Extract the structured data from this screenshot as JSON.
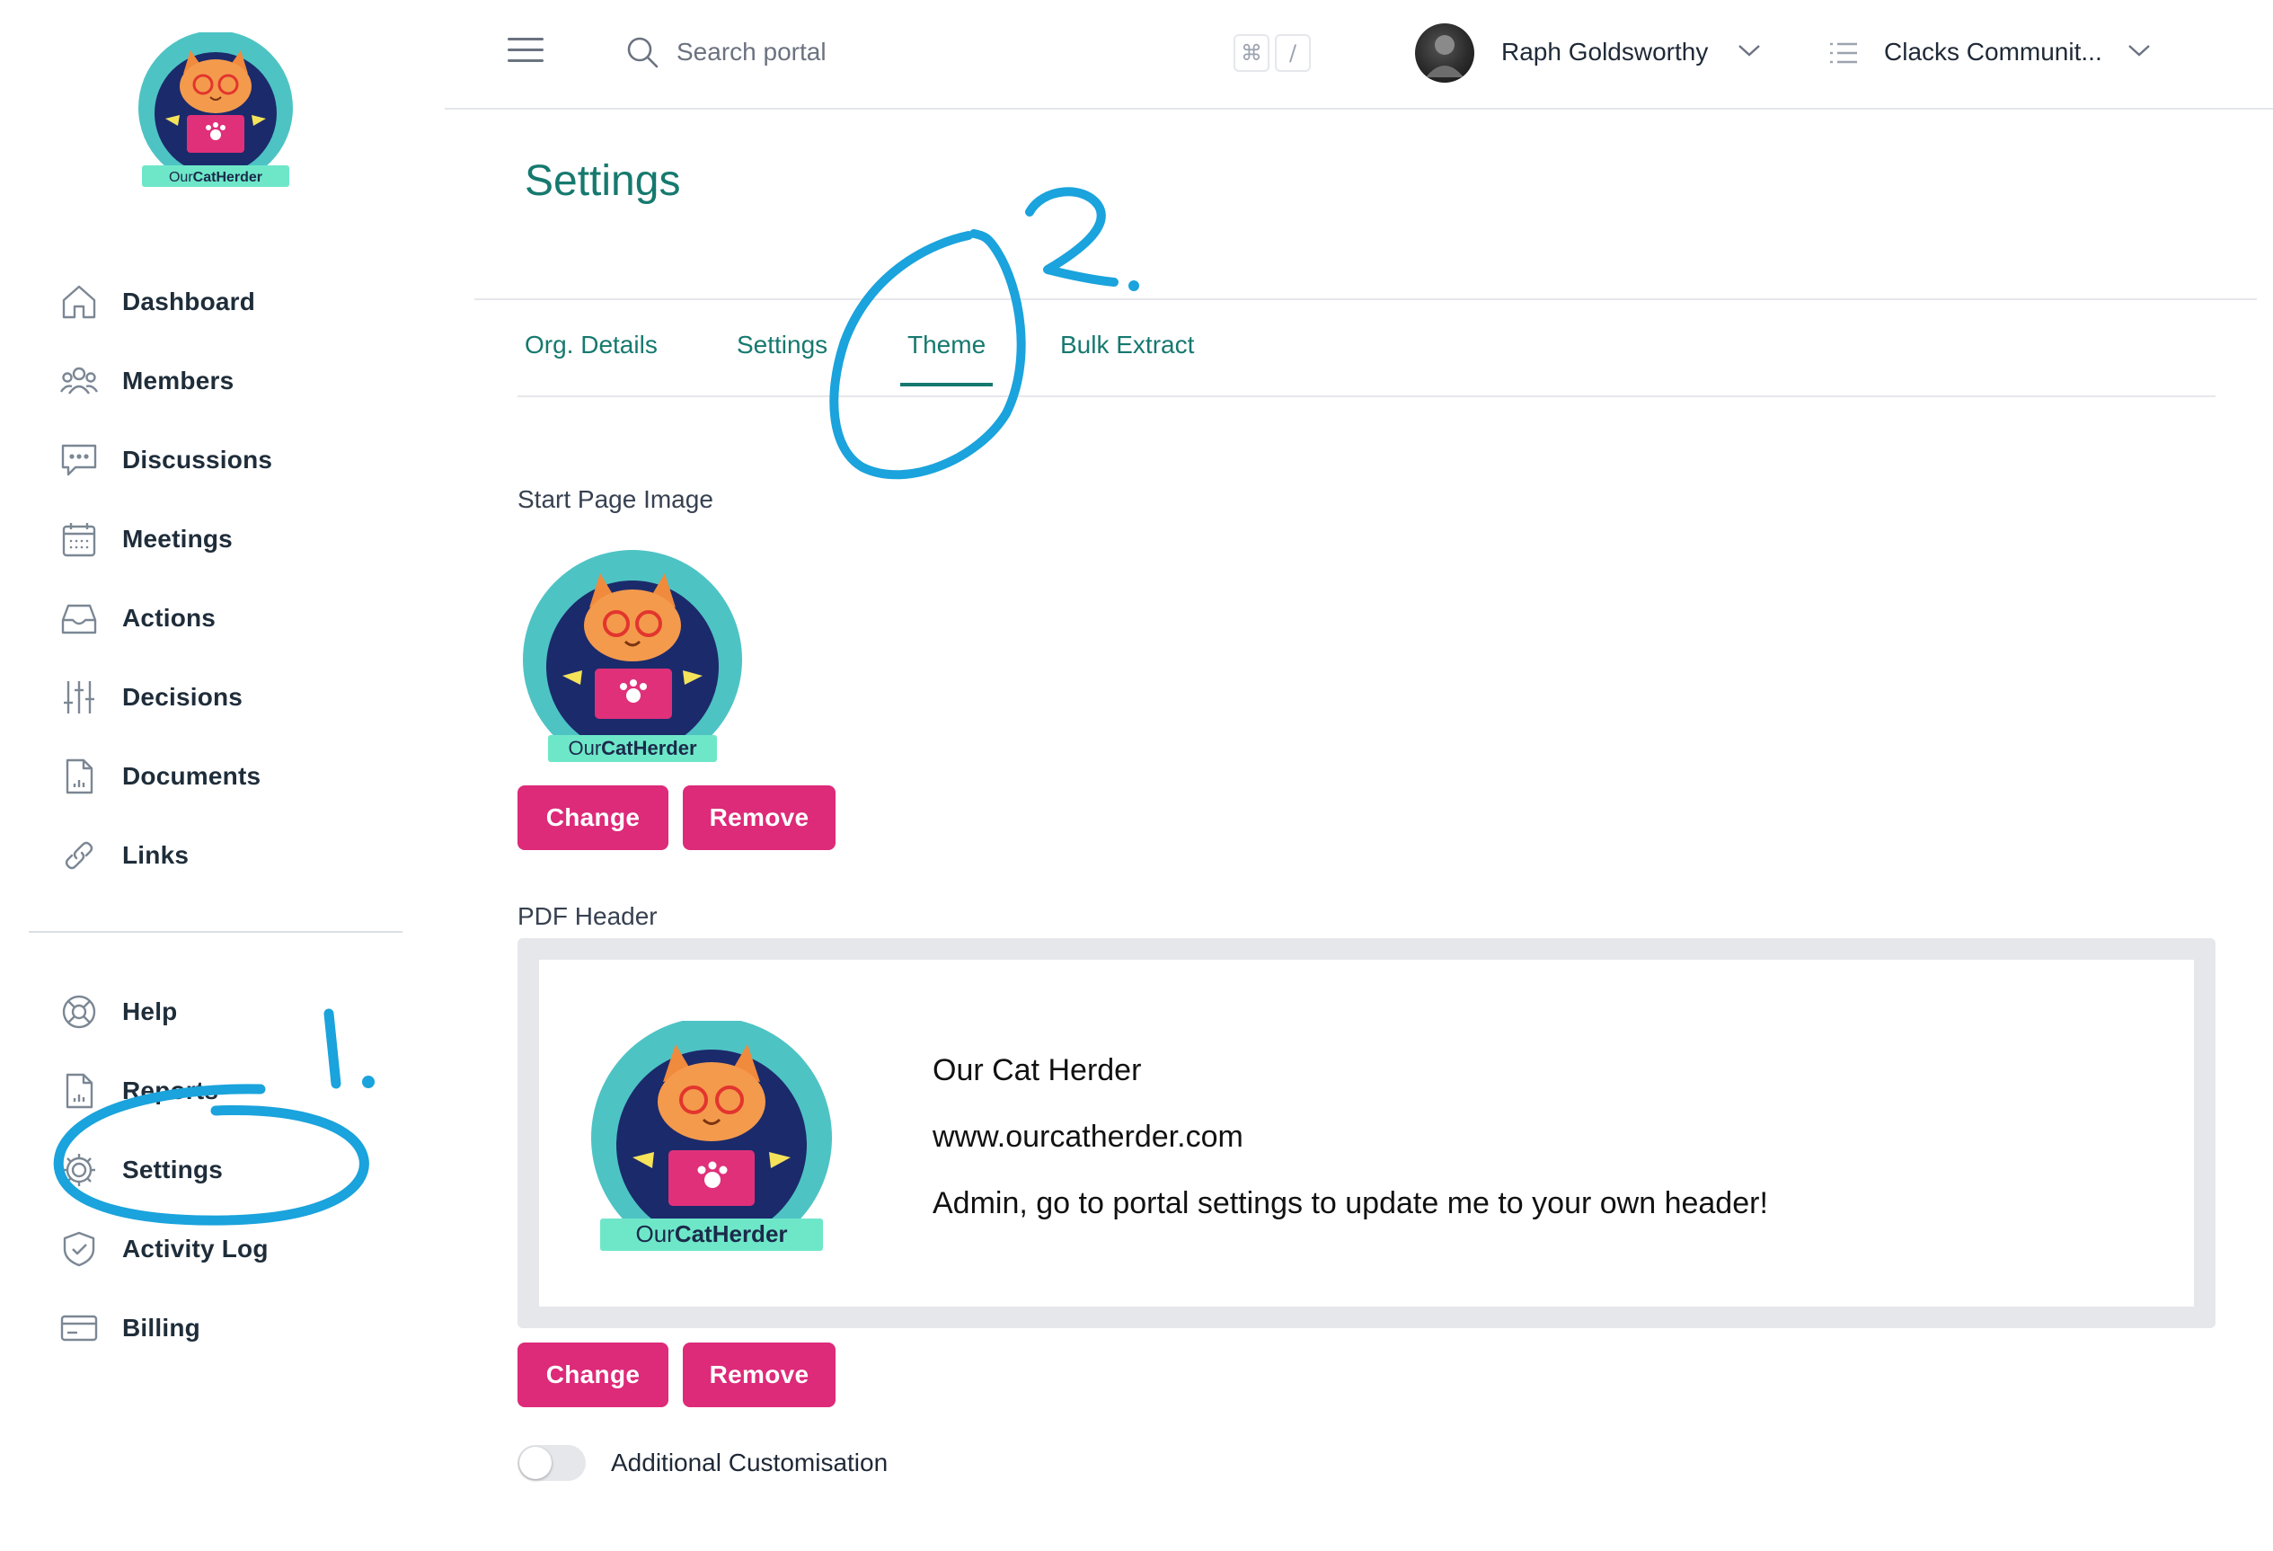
{
  "app": {
    "logo_text_our": "Our",
    "logo_text_brand": "CatHerder"
  },
  "sidebar": {
    "items": [
      {
        "label": "Dashboard",
        "icon": "home-icon"
      },
      {
        "label": "Members",
        "icon": "users-icon"
      },
      {
        "label": "Discussions",
        "icon": "chat-icon"
      },
      {
        "label": "Meetings",
        "icon": "calendar-icon"
      },
      {
        "label": "Actions",
        "icon": "inbox-icon"
      },
      {
        "label": "Decisions",
        "icon": "sliders-icon"
      },
      {
        "label": "Documents",
        "icon": "document-icon"
      },
      {
        "label": "Links",
        "icon": "link-icon"
      }
    ],
    "secondary_items": [
      {
        "label": "Help",
        "icon": "lifebuoy-icon"
      },
      {
        "label": "Reports",
        "icon": "report-icon"
      },
      {
        "label": "Settings",
        "icon": "gear-icon"
      },
      {
        "label": "Activity Log",
        "icon": "shield-icon"
      },
      {
        "label": "Billing",
        "icon": "credit-card-icon"
      }
    ]
  },
  "topbar": {
    "search_placeholder": "Search portal",
    "shortcut_key_1": "⌘",
    "shortcut_key_2": "/",
    "user_name": "Raph Goldsworthy",
    "org_name": "Clacks Communit..."
  },
  "main": {
    "title": "Settings",
    "tabs": [
      {
        "label": "Org. Details",
        "active": false
      },
      {
        "label": "Settings",
        "active": false
      },
      {
        "label": "Theme",
        "active": true
      },
      {
        "label": "Bulk Extract",
        "active": false
      }
    ],
    "start_page_image_label": "Start Page Image",
    "change_label": "Change",
    "remove_label": "Remove",
    "pdf_header_label": "PDF Header",
    "pdf_header_lines": [
      "Our Cat Herder",
      "www.ourcatherder.com",
      "Admin, go to portal settings to update me to your own header!"
    ],
    "additional_customisation_label": "Additional Customisation",
    "additional_customisation_enabled": false
  },
  "annotations": {
    "mark_1": "1.",
    "mark_2": "2."
  },
  "colors": {
    "teal": "#16796f",
    "pink": "#dd2a79",
    "annotation_blue": "#1aa3dc"
  }
}
